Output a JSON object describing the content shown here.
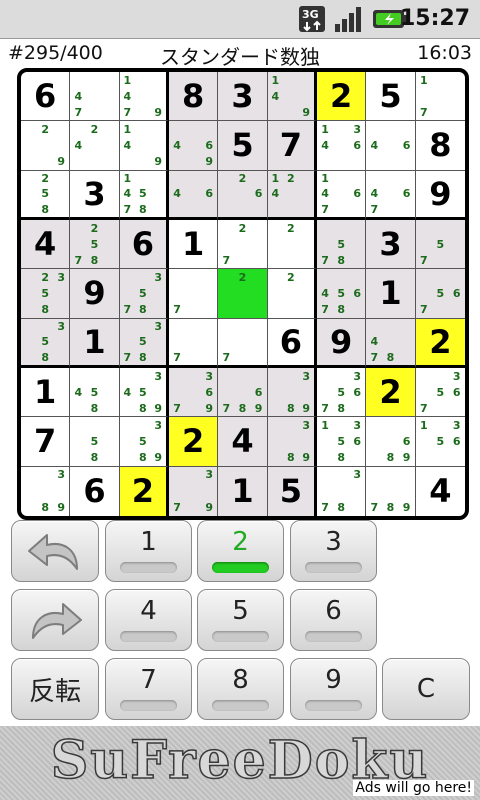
{
  "status_bar": {
    "time": "15:27",
    "network": "3G",
    "network_icon": "3g-data-icon",
    "signal_icon": "signal-strength-icon",
    "battery_icon": "battery-charging-icon"
  },
  "header": {
    "puzzle_number": "#295/400",
    "title": "スタンダード数独",
    "timer": "16:03"
  },
  "board": {
    "rows": [
      [
        {
          "v": "6"
        },
        {
          "c": [
            "4",
            "7"
          ]
        },
        {
          "c": [
            "1",
            "4",
            "7",
            "9"
          ]
        },
        {
          "v": "8"
        },
        {
          "v": "3"
        },
        {
          "c": [
            "1",
            "4",
            "9"
          ]
        },
        {
          "v": "2"
        },
        {
          "v": "5"
        },
        {
          "c": [
            "1",
            "7"
          ]
        }
      ],
      [
        {
          "c": [
            "2",
            "9"
          ]
        },
        {
          "c": [
            "2",
            "4"
          ]
        },
        {
          "c": [
            "1",
            "4",
            "9"
          ]
        },
        {
          "c": [
            "4",
            "6",
            "9"
          ]
        },
        {
          "v": "5"
        },
        {
          "v": "7"
        },
        {
          "c": [
            "1",
            "3",
            "4",
            "6"
          ]
        },
        {
          "c": [
            "4",
            "6"
          ]
        },
        {
          "v": "8"
        }
      ],
      [
        {
          "c": [
            "2",
            "5",
            "8"
          ]
        },
        {
          "v": "3"
        },
        {
          "c": [
            "1",
            "4",
            "5",
            "7",
            "8"
          ]
        },
        {
          "c": [
            "4",
            "6"
          ]
        },
        {
          "c": [
            "2",
            "6"
          ]
        },
        {
          "c": [
            "1",
            "2",
            "4"
          ]
        },
        {
          "c": [
            "1",
            "4",
            "6",
            "7"
          ]
        },
        {
          "c": [
            "4",
            "6",
            "7"
          ]
        },
        {
          "v": "9"
        }
      ],
      [
        {
          "v": "4"
        },
        {
          "c": [
            "2",
            "5",
            "7",
            "8"
          ]
        },
        {
          "v": "6"
        },
        {
          "v": "1"
        },
        {
          "c": [
            "2",
            "7"
          ]
        },
        {
          "c": [
            "2"
          ]
        },
        {
          "c": [
            "5",
            "7",
            "8"
          ]
        },
        {
          "v": "3"
        },
        {
          "c": [
            "5",
            "7"
          ]
        }
      ],
      [
        {
          "c": [
            "2",
            "3",
            "5",
            "8"
          ]
        },
        {
          "v": "9"
        },
        {
          "c": [
            "3",
            "5",
            "7",
            "8"
          ]
        },
        {
          "c": [
            "7"
          ]
        },
        {
          "c": [
            "2"
          ]
        },
        {
          "c": [
            "2"
          ]
        },
        {
          "c": [
            "4",
            "5",
            "6",
            "7",
            "8"
          ]
        },
        {
          "v": "1"
        },
        {
          "c": [
            "5",
            "6",
            "7"
          ]
        }
      ],
      [
        {
          "c": [
            "3",
            "5",
            "8"
          ]
        },
        {
          "v": "1"
        },
        {
          "c": [
            "3",
            "5",
            "7",
            "8"
          ]
        },
        {
          "c": [
            "7"
          ]
        },
        {
          "c": [
            "7"
          ]
        },
        {
          "v": "6"
        },
        {
          "v": "9"
        },
        {
          "c": [
            "4",
            "7",
            "8"
          ]
        },
        {
          "v": "2"
        }
      ],
      [
        {
          "v": "1"
        },
        {
          "c": [
            "4",
            "5",
            "8"
          ]
        },
        {
          "c": [
            "3",
            "4",
            "5",
            "8",
            "9"
          ]
        },
        {
          "c": [
            "3",
            "6",
            "7",
            "9"
          ]
        },
        {
          "c": [
            "6",
            "7",
            "8",
            "9"
          ]
        },
        {
          "c": [
            "3",
            "8",
            "9"
          ]
        },
        {
          "c": [
            "3",
            "5",
            "6",
            "7",
            "8"
          ]
        },
        {
          "v": "2"
        },
        {
          "c": [
            "3",
            "5",
            "6",
            "7"
          ]
        }
      ],
      [
        {
          "v": "7"
        },
        {
          "c": [
            "5",
            "8"
          ]
        },
        {
          "c": [
            "3",
            "5",
            "8",
            "9"
          ]
        },
        {
          "v": "2"
        },
        {
          "v": "4"
        },
        {
          "c": [
            "3",
            "8",
            "9"
          ]
        },
        {
          "c": [
            "1",
            "3",
            "5",
            "6",
            "8"
          ]
        },
        {
          "c": [
            "6",
            "8",
            "9"
          ]
        },
        {
          "c": [
            "1",
            "3",
            "5",
            "6"
          ]
        }
      ],
      [
        {
          "c": [
            "3",
            "8",
            "9"
          ]
        },
        {
          "v": "6"
        },
        {
          "v": "2"
        },
        {
          "c": [
            "3",
            "7",
            "9"
          ]
        },
        {
          "v": "1"
        },
        {
          "v": "5"
        },
        {
          "c": [
            "3",
            "7",
            "8"
          ]
        },
        {
          "c": [
            "7",
            "8",
            "9"
          ]
        },
        {
          "v": "4"
        }
      ]
    ],
    "highlighted_digit": "2",
    "selected_cell_color": "#22dd22",
    "highlight_color": "#ffff22",
    "shade_color": "#e6e2e6",
    "white_color": "#ffffff"
  },
  "keypad": {
    "undo_icon": "undo-arrow-icon",
    "redo_icon": "redo-arrow-icon",
    "invert_label": "反転",
    "clear_label": "C",
    "digits": [
      "1",
      "2",
      "3",
      "4",
      "5",
      "6",
      "7",
      "8",
      "9"
    ],
    "active_digit": "2",
    "active_color": "#22aa22"
  },
  "footer": {
    "title": "SuFreeDoku",
    "ad_text": "Ads will go here!"
  }
}
